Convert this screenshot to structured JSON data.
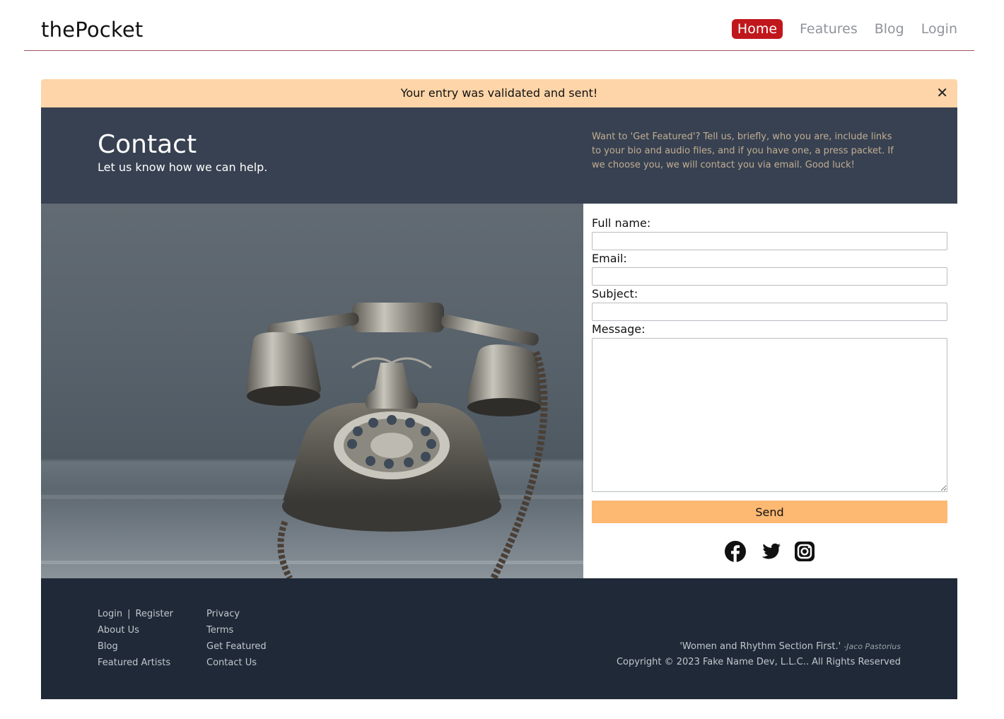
{
  "header": {
    "brand": "thePocket",
    "nav": {
      "home": "Home",
      "features": "Features",
      "blog": "Blog",
      "login": "Login"
    }
  },
  "alert": {
    "message": "Your entry was validated and sent!",
    "close": "✕"
  },
  "banner": {
    "title": "Contact",
    "subtitle": "Let us know how we can help.",
    "note": "Want to 'Get Featured'? Tell us, briefly, who you are, include links to your bio and audio files, and if you have one, a press packet. If we choose you, we will contact you via email. Good luck!"
  },
  "form": {
    "name_label": "Full name:",
    "email_label": "Email:",
    "subject_label": "Subject:",
    "message_label": "Message:",
    "send_label": "Send",
    "social_icons": [
      "facebook-icon",
      "twitter-icon",
      "instagram-icon"
    ]
  },
  "footer": {
    "col1": {
      "login": "Login",
      "register": "Register",
      "about": "About Us",
      "blog": "Blog",
      "artists": "Featured Artists"
    },
    "col2": {
      "privacy": "Privacy",
      "terms": "Terms",
      "featured": "Get Featured",
      "contact": "Contact Us"
    },
    "quote": "'Women and Rhythm Section First.'",
    "quote_author": "-Jaco Pastorius",
    "copyright": "Copyright © 2023 Fake Name Dev, L.L.C.. All Rights Reserved"
  },
  "colors": {
    "accent": "#c0171c",
    "alert_bg": "#fed5a8",
    "banner_bg": "#374151",
    "footer_bg": "#1f2937",
    "send_bg": "#fdb872"
  }
}
